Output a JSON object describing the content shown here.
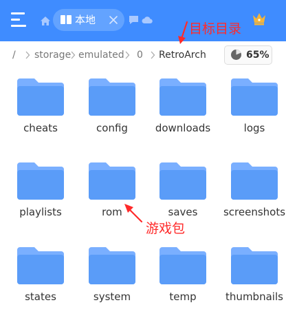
{
  "topbar": {
    "tab_label": "本地",
    "bg_color": "#3f8cff",
    "icons": [
      "menu-icon",
      "home-icon",
      "book-icon",
      "close-icon",
      "chat-icon",
      "cloud-icon",
      "crown-icon"
    ]
  },
  "annotations": {
    "target_dir": "目标目录",
    "game_pack": "游戏包",
    "color": "#ff2a2a"
  },
  "breadcrumb": {
    "root": "/",
    "items": [
      "storage",
      "emulated",
      "0",
      "RetroArch"
    ]
  },
  "storage": {
    "used": "65%"
  },
  "folders": [
    "cheats",
    "config",
    "downloads",
    "logs",
    "playlists",
    "rom",
    "saves",
    "screenshots",
    "states",
    "system",
    "temp",
    "thumbnails"
  ]
}
